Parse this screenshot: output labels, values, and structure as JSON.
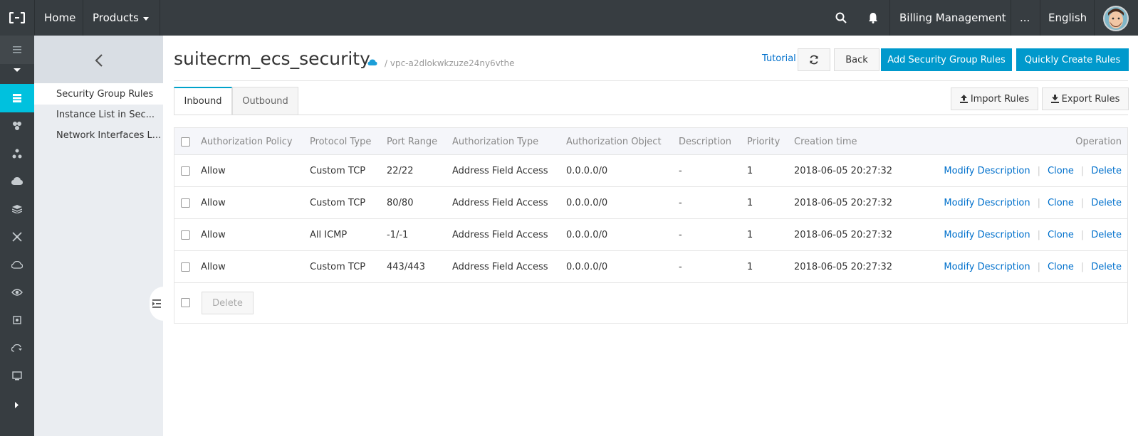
{
  "topbar": {
    "logo": "alibaba-cloud-logo",
    "home": "Home",
    "products": "Products",
    "billing": "Billing Management",
    "more": "...",
    "language": "English"
  },
  "sidebar": {
    "items": [
      {
        "label": "Security Group Rules"
      },
      {
        "label": "Instance List in Sec..."
      },
      {
        "label": "Network Interfaces L..."
      }
    ]
  },
  "header": {
    "title": "suitecrm_ecs_security",
    "vpc": "/ vpc-a2dlokwkzuze24ny6vthe",
    "tutorial": "Tutorial",
    "back": "Back",
    "add_rules": "Add Security Group Rules",
    "quick_create": "Quickly Create Rules"
  },
  "tabs": [
    {
      "label": "Inbound",
      "active": true
    },
    {
      "label": "Outbound",
      "active": false
    }
  ],
  "toolbar": {
    "import": "Import Rules",
    "export": "Export Rules"
  },
  "table": {
    "columns": [
      "Authorization Policy",
      "Protocol Type",
      "Port Range",
      "Authorization Type",
      "Authorization Object",
      "Description",
      "Priority",
      "Creation time",
      "Operation"
    ],
    "rows": [
      {
        "policy": "Allow",
        "protocol": "Custom TCP",
        "port": "22/22",
        "auth_type": "Address Field Access",
        "object": "0.0.0.0/0",
        "description": "-",
        "priority": "1",
        "created": "2018-06-05 20:27:32"
      },
      {
        "policy": "Allow",
        "protocol": "Custom TCP",
        "port": "80/80",
        "auth_type": "Address Field Access",
        "object": "0.0.0.0/0",
        "description": "-",
        "priority": "1",
        "created": "2018-06-05 20:27:32"
      },
      {
        "policy": "Allow",
        "protocol": "All ICMP",
        "port": "-1/-1",
        "auth_type": "Address Field Access",
        "object": "0.0.0.0/0",
        "description": "-",
        "priority": "1",
        "created": "2018-06-05 20:27:32"
      },
      {
        "policy": "Allow",
        "protocol": "Custom TCP",
        "port": "443/443",
        "auth_type": "Address Field Access",
        "object": "0.0.0.0/0",
        "description": "-",
        "priority": "1",
        "created": "2018-06-05 20:27:32"
      }
    ],
    "actions": {
      "modify": "Modify Description",
      "clone": "Clone",
      "delete": "Delete",
      "sep": "|"
    },
    "footer_delete": "Delete"
  },
  "colors": {
    "accent": "#00c1de",
    "primary_button": "#0099cc",
    "link": "#0070cc",
    "topbar": "#373d41"
  }
}
